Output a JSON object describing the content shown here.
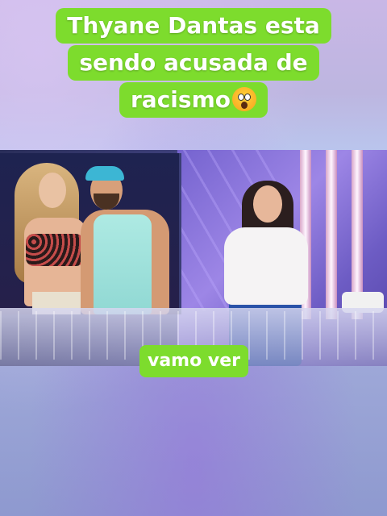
{
  "headline": {
    "line1": "Thyane Dantas esta",
    "line2": "sendo acusada de",
    "line3": "racismo",
    "emoji_icon": "screaming-face-icon"
  },
  "caption": {
    "text": "vamo ver"
  },
  "colors": {
    "label_green": "#7ddc2d",
    "label_text": "#ffffff"
  }
}
